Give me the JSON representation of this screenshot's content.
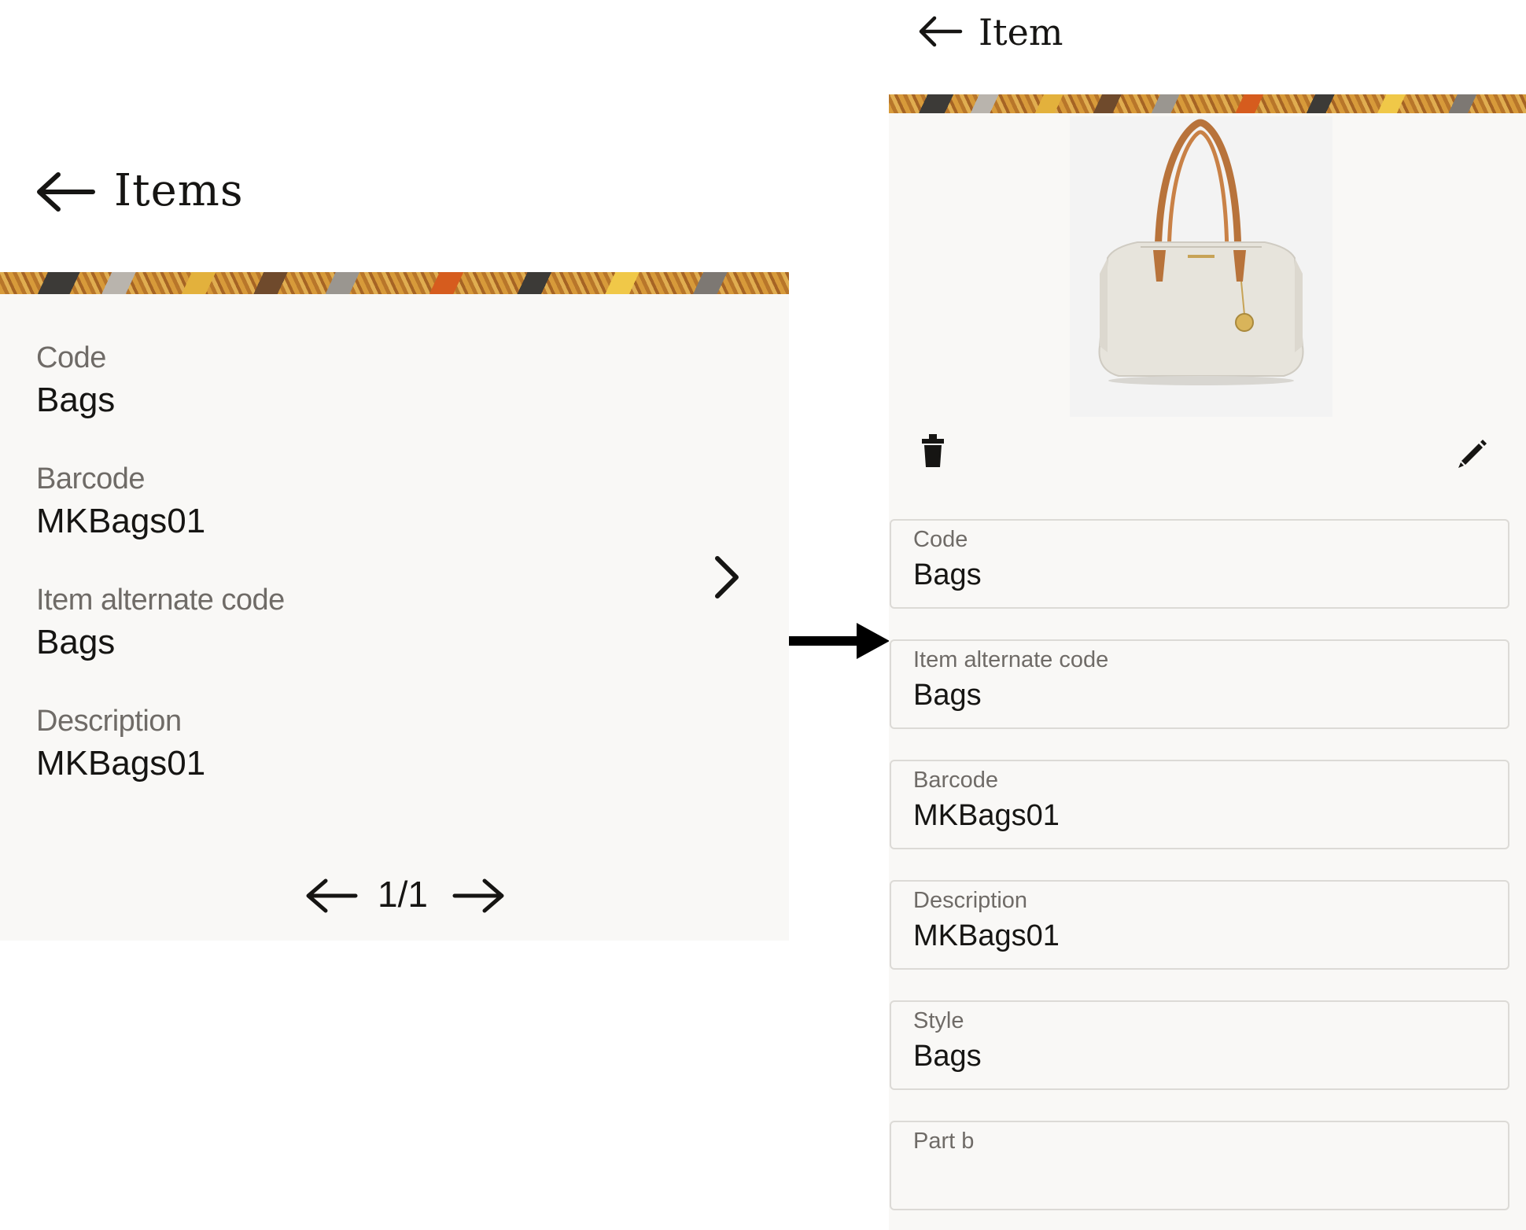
{
  "list_screen": {
    "title": "Items",
    "fields": [
      {
        "label": "Code",
        "value": "Bags"
      },
      {
        "label": "Barcode",
        "value": "MKBags01"
      },
      {
        "label": "Item alternate code",
        "value": "Bags"
      },
      {
        "label": "Description",
        "value": "MKBags01"
      }
    ],
    "pager": "1/1"
  },
  "detail_screen": {
    "title": "Item",
    "fields": [
      {
        "label": "Code",
        "value": "Bags"
      },
      {
        "label": "Item alternate code",
        "value": "Bags"
      },
      {
        "label": "Barcode",
        "value": "MKBags01"
      },
      {
        "label": "Description",
        "value": "MKBags01"
      },
      {
        "label": "Style",
        "value": "Bags"
      },
      {
        "label": "Part b",
        "value": ""
      }
    ]
  },
  "icons": {
    "back": "arrow-left-icon",
    "next_record": "chevron-right-icon",
    "prev_page": "arrow-left-icon",
    "next_page": "arrow-right-icon",
    "transition": "arrow-right-icon",
    "delete": "trash-icon",
    "edit": "pencil-icon"
  },
  "colors": {
    "text": "#161513",
    "label": "#6f6b67",
    "panel": "#f9f8f6",
    "card_border": "#dcdad6",
    "banner": "#c98a2e"
  }
}
